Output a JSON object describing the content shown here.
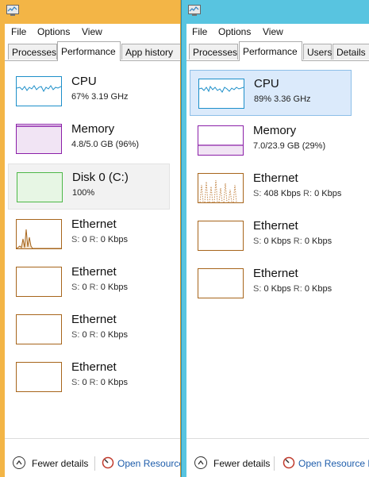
{
  "left": {
    "menu": [
      "File",
      "Options",
      "View"
    ],
    "tabs": [
      "Processes",
      "Performance",
      "App history"
    ],
    "items": [
      {
        "name": "CPU",
        "detail": "67%  3.19 GHz"
      },
      {
        "name": "Memory",
        "detail": "4.8/5.0 GB (96%)"
      },
      {
        "name": "Disk 0 (C:)",
        "detail": "100%"
      },
      {
        "name": "Ethernet",
        "s_label": "S:",
        "s_value": "0",
        "r_label": "R:",
        "r_value": "0 Kbps"
      },
      {
        "name": "Ethernet",
        "s_label": "S:",
        "s_value": "0",
        "r_label": "R:",
        "r_value": "0 Kbps"
      },
      {
        "name": "Ethernet",
        "s_label": "S:",
        "s_value": "0",
        "r_label": "R:",
        "r_value": "0 Kbps"
      },
      {
        "name": "Ethernet",
        "s_label": "S:",
        "s_value": "0",
        "r_label": "R:",
        "r_value": "0 Kbps"
      }
    ],
    "footer": {
      "fewer": "Fewer details",
      "open": "Open Resource"
    }
  },
  "right": {
    "menu": [
      "File",
      "Options",
      "View"
    ],
    "tabs": [
      "Processes",
      "Performance",
      "Users",
      "Details"
    ],
    "items": [
      {
        "name": "CPU",
        "detail": "89%  3.36 GHz"
      },
      {
        "name": "Memory",
        "detail": "7.0/23.9 GB (29%)"
      },
      {
        "name": "Ethernet",
        "s_label": "S:",
        "s_value": "408 Kbps",
        "r_label": "R:",
        "r_value": "0 Kbps"
      },
      {
        "name": "Ethernet",
        "s_label": "S:",
        "s_value": "0 Kbps",
        "r_label": "R:",
        "r_value": "0 Kbps"
      },
      {
        "name": "Ethernet",
        "s_label": "S:",
        "s_value": "0 Kbps",
        "r_label": "R:",
        "r_value": "0 Kbps"
      }
    ],
    "footer": {
      "fewer": "Fewer details",
      "open": "Open Resource M"
    }
  },
  "colors": {
    "cpu": "#1d8fc9",
    "memory": "#8b1fa8",
    "disk": "#4db848",
    "ethernet": "#a7651b",
    "left_frame": "#f3b546",
    "right_frame": "#58c4e0",
    "selected_blue": "#dbeafb",
    "link": "#1e5dab"
  },
  "icons": [
    "task-manager-icon",
    "collapse-chevron-icon",
    "resource-monitor-icon"
  ]
}
